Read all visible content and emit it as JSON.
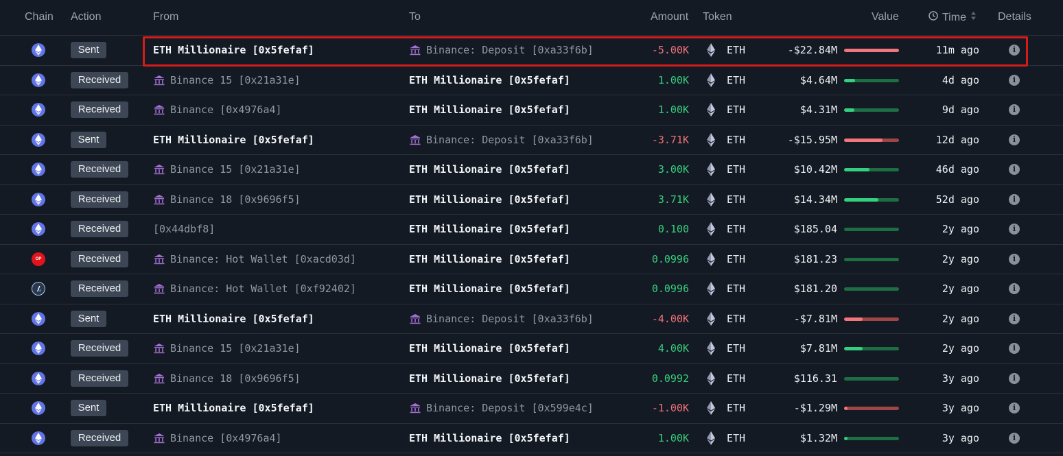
{
  "headers": {
    "chain": "Chain",
    "action": "Action",
    "from": "From",
    "to": "To",
    "amount": "Amount",
    "token": "Token",
    "value": "Value",
    "time": "Time",
    "details": "Details"
  },
  "colors": {
    "background": "#141a23",
    "positive": "#35d07f",
    "negative": "#f0737a",
    "highlight": "#d61b1b",
    "badge": "#3d4654"
  },
  "highlighted_row": 0,
  "rows": [
    {
      "chain": "ethereum",
      "action": "Sent",
      "from": "ETH Millionaire [0x5fefaf]",
      "from_icon": false,
      "to": "Binance: Deposit [0xa33f6b]",
      "to_icon": true,
      "amount": "-5.00K",
      "token": "ETH",
      "value": "-$22.84M",
      "bar": 1.0,
      "time": "11m ago"
    },
    {
      "chain": "ethereum",
      "action": "Received",
      "from": "Binance 15 [0x21a31e]",
      "from_icon": true,
      "to": "ETH Millionaire [0x5fefaf]",
      "to_icon": false,
      "amount": "1.00K",
      "token": "ETH",
      "value": "$4.64M",
      "bar": 0.2,
      "time": "4d ago"
    },
    {
      "chain": "ethereum",
      "action": "Received",
      "from": "Binance [0x4976a4]",
      "from_icon": true,
      "to": "ETH Millionaire [0x5fefaf]",
      "to_icon": false,
      "amount": "1.00K",
      "token": "ETH",
      "value": "$4.31M",
      "bar": 0.19,
      "time": "9d ago"
    },
    {
      "chain": "ethereum",
      "action": "Sent",
      "from": "ETH Millionaire [0x5fefaf]",
      "from_icon": false,
      "to": "Binance: Deposit [0xa33f6b]",
      "to_icon": true,
      "amount": "-3.71K",
      "token": "ETH",
      "value": "-$15.95M",
      "bar": 0.7,
      "time": "12d ago"
    },
    {
      "chain": "ethereum",
      "action": "Received",
      "from": "Binance 15 [0x21a31e]",
      "from_icon": true,
      "to": "ETH Millionaire [0x5fefaf]",
      "to_icon": false,
      "amount": "3.00K",
      "token": "ETH",
      "value": "$10.42M",
      "bar": 0.46,
      "time": "46d ago"
    },
    {
      "chain": "ethereum",
      "action": "Received",
      "from": "Binance 18 [0x9696f5]",
      "from_icon": true,
      "to": "ETH Millionaire [0x5fefaf]",
      "to_icon": false,
      "amount": "3.71K",
      "token": "ETH",
      "value": "$14.34M",
      "bar": 0.63,
      "time": "52d ago"
    },
    {
      "chain": "ethereum",
      "action": "Received",
      "from": "[0x44dbf8]",
      "from_icon": false,
      "to": "ETH Millionaire [0x5fefaf]",
      "to_icon": false,
      "amount": "0.100",
      "token": "ETH",
      "value": "$185.04",
      "bar": 0.0,
      "time": "2y ago"
    },
    {
      "chain": "optimism",
      "action": "Received",
      "from": "Binance: Hot Wallet [0xacd03d]",
      "from_icon": true,
      "to": "ETH Millionaire [0x5fefaf]",
      "to_icon": false,
      "amount": "0.0996",
      "token": "ETH",
      "value": "$181.23",
      "bar": 0.0,
      "time": "2y ago"
    },
    {
      "chain": "arbitrum",
      "action": "Received",
      "from": "Binance: Hot Wallet [0xf92402]",
      "from_icon": true,
      "to": "ETH Millionaire [0x5fefaf]",
      "to_icon": false,
      "amount": "0.0996",
      "token": "ETH",
      "value": "$181.20",
      "bar": 0.0,
      "time": "2y ago"
    },
    {
      "chain": "ethereum",
      "action": "Sent",
      "from": "ETH Millionaire [0x5fefaf]",
      "from_icon": false,
      "to": "Binance: Deposit [0xa33f6b]",
      "to_icon": true,
      "amount": "-4.00K",
      "token": "ETH",
      "value": "-$7.81M",
      "bar": 0.34,
      "time": "2y ago"
    },
    {
      "chain": "ethereum",
      "action": "Received",
      "from": "Binance 15 [0x21a31e]",
      "from_icon": true,
      "to": "ETH Millionaire [0x5fefaf]",
      "to_icon": false,
      "amount": "4.00K",
      "token": "ETH",
      "value": "$7.81M",
      "bar": 0.34,
      "time": "2y ago"
    },
    {
      "chain": "ethereum",
      "action": "Received",
      "from": "Binance 18 [0x9696f5]",
      "from_icon": true,
      "to": "ETH Millionaire [0x5fefaf]",
      "to_icon": false,
      "amount": "0.0992",
      "token": "ETH",
      "value": "$116.31",
      "bar": 0.0,
      "time": "3y ago"
    },
    {
      "chain": "ethereum",
      "action": "Sent",
      "from": "ETH Millionaire [0x5fefaf]",
      "from_icon": false,
      "to": "Binance: Deposit [0x599e4c]",
      "to_icon": true,
      "amount": "-1.00K",
      "token": "ETH",
      "value": "-$1.29M",
      "bar": 0.06,
      "time": "3y ago"
    },
    {
      "chain": "ethereum",
      "action": "Received",
      "from": "Binance [0x4976a4]",
      "from_icon": true,
      "to": "ETH Millionaire [0x5fefaf]",
      "to_icon": false,
      "amount": "1.00K",
      "token": "ETH",
      "value": "$1.32M",
      "bar": 0.06,
      "time": "3y ago"
    }
  ]
}
